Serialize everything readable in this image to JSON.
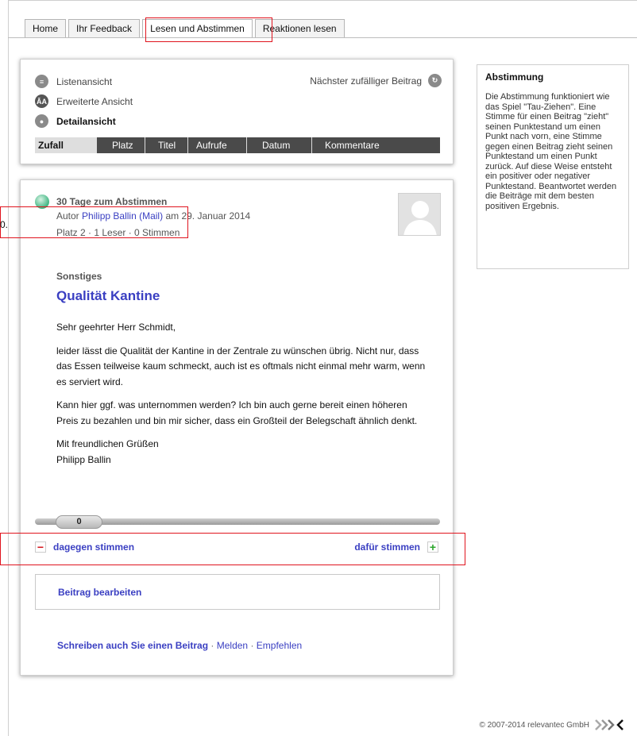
{
  "tabs": [
    {
      "label": "Home"
    },
    {
      "label": "Ihr Feedback"
    },
    {
      "label": "Lesen und Abstimmen"
    },
    {
      "label": "Reaktionen lesen"
    }
  ],
  "views": {
    "list": "Listenansicht",
    "extended": "Erweiterte Ansicht",
    "detail": "Detailansicht",
    "random": "Nächster zufälliger Beitrag",
    "sort": [
      "Zufall",
      "Platz",
      "Titel",
      "Aufrufe",
      "Datum",
      "Kommentare"
    ]
  },
  "article": {
    "days": "30 Tage zum Abstimmen",
    "author_prefix": "Autor",
    "author": "Philipp Ballin",
    "mail_open": "(",
    "mail": "Mail",
    "mail_close": ")",
    "date": "am 29. Januar 2014",
    "stats": "Platz 2 · 1 Leser · 0 Stimmen",
    "category": "Sonstiges",
    "title": "Qualität Kantine",
    "paragraphs": [
      "Sehr geehrter Herr Schmidt,",
      "leider lässt die Qualität der Kantine in der Zentrale zu wünschen übrig. Nicht nur, dass das Essen teilweise kaum schmeckt, auch ist es oftmals nicht einmal mehr warm, wenn es serviert wird.",
      "Kann hier ggf. was unternommen werden? Ich bin auch gerne bereit einen höheren Preis zu bezahlen und bin mir sicher, dass ein Großteil der Belegschaft ähnlich denkt.",
      "Mit freundlichen Grüßen\nPhilipp Ballin"
    ],
    "score": "0",
    "against": "dagegen stimmen",
    "for": "dafür stimmen",
    "edit": "Beitrag bearbeiten",
    "write": "Schreiben auch Sie einen Beitrag",
    "sep": "·",
    "report": "Melden",
    "recommend": "Empfehlen"
  },
  "sidebar": {
    "title": "Abstimmung",
    "text": "Die Abstimmung funktioniert wie das Spiel \"Tau-Ziehen\". Eine Stimme für einen Beitrag \"zieht\" seinen Punktestand um einen Punkt nach vorn, eine Stimme gegen einen Beitrag zieht seinen Punktestand um einen Punkt zurück. Auf diese Weise entsteht ein positiver oder negativer Punktestand. Beantwortet werden die Beiträge mit dem besten positiven Ergebnis."
  },
  "annotation_fragment": "0.",
  "footer": {
    "copyright": "© 2007-2014 relevantec GmbH"
  },
  "colors": {
    "link": "#3a3fc2",
    "highlight": "#e0141e",
    "sortbar": "#4a4a4a",
    "plus": "#2aa52a",
    "minus": "#d4141c"
  }
}
